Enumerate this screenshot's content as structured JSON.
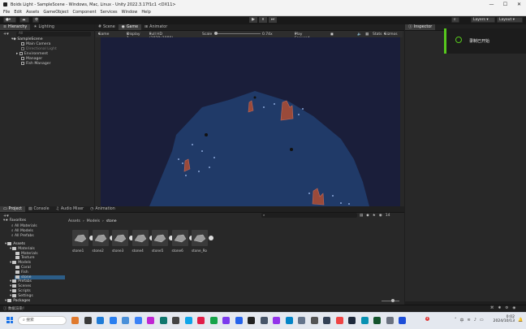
{
  "window": {
    "title": "Boids Light - SampleScene - Windows, Mac, Linux - Unity 2022.3.17f1c1 <DX11>",
    "controls": [
      "—",
      "☐",
      "✕"
    ]
  },
  "menu": [
    "File",
    "Edit",
    "Assets",
    "GameObject",
    "Component",
    "Services",
    "Window",
    "Help"
  ],
  "toolbar": {
    "layers_label": "Layers",
    "layout_label": "Layout",
    "play_icons": [
      "▶",
      "⏸",
      "⏭"
    ]
  },
  "hierarchy": {
    "tab": "Hierarchy",
    "lighting_tab": "Lighting",
    "search_placeholder": "All",
    "scene": "SampleScene",
    "items": [
      {
        "label": "Main Camera",
        "dim": false
      },
      {
        "label": "Directional Light",
        "dim": true
      },
      {
        "label": "Environment",
        "dim": false
      },
      {
        "label": "Manager",
        "dim": false
      },
      {
        "label": "Fish Manager",
        "dim": false
      }
    ]
  },
  "center": {
    "tabs": [
      "Scene",
      "Game",
      "Animator"
    ],
    "gamebar": {
      "mode": "Game",
      "display": "Display 1",
      "resolution": "Full HD (1920x1080)",
      "scale_label": "Scale",
      "scale_value": "0.74x",
      "play_focused": "Play Focused",
      "stats": "Stats",
      "gizmos": "Gizmos"
    }
  },
  "inspector": {
    "tab": "Inspector"
  },
  "toast": {
    "text": "录制已开始"
  },
  "bottom": {
    "tabs": [
      "Project",
      "Console",
      "Audio Mixer",
      "Animation"
    ],
    "favorites": {
      "label": "Favorites",
      "items": [
        "All Materials",
        "All Models",
        "All Prefabs"
      ]
    },
    "assets_tree": [
      {
        "label": "Assets",
        "level": 0
      },
      {
        "label": "Materials",
        "level": 1
      },
      {
        "label": "Materials",
        "level": 2
      },
      {
        "label": "Texture",
        "level": 2
      },
      {
        "label": "Models",
        "level": 1
      },
      {
        "label": "Coral",
        "level": 2
      },
      {
        "label": "Fish",
        "level": 2
      },
      {
        "label": "stone",
        "level": 2
      },
      {
        "label": "Prefabs",
        "level": 1
      },
      {
        "label": "Scenes",
        "level": 1
      },
      {
        "label": "Scripts",
        "level": 1
      },
      {
        "label": "Settings",
        "level": 1
      },
      {
        "label": "Packages",
        "level": 0
      }
    ],
    "breadcrumb": [
      "Assets",
      "Models",
      "stone"
    ],
    "assets": [
      "stone1",
      "stone2",
      "stone3",
      "stone4",
      "stone5",
      "stone6",
      "stone_Ro"
    ],
    "count_badge": "14"
  },
  "status": {
    "text": "数据渲染！"
  },
  "taskbar": {
    "search_placeholder": "搜索",
    "time": "0:02",
    "date": "2024/10/13",
    "badge": "4"
  },
  "colors": {
    "accent_green": "#57c81d",
    "game_bg": "#1a1e3a",
    "terrain": "#203a68"
  }
}
